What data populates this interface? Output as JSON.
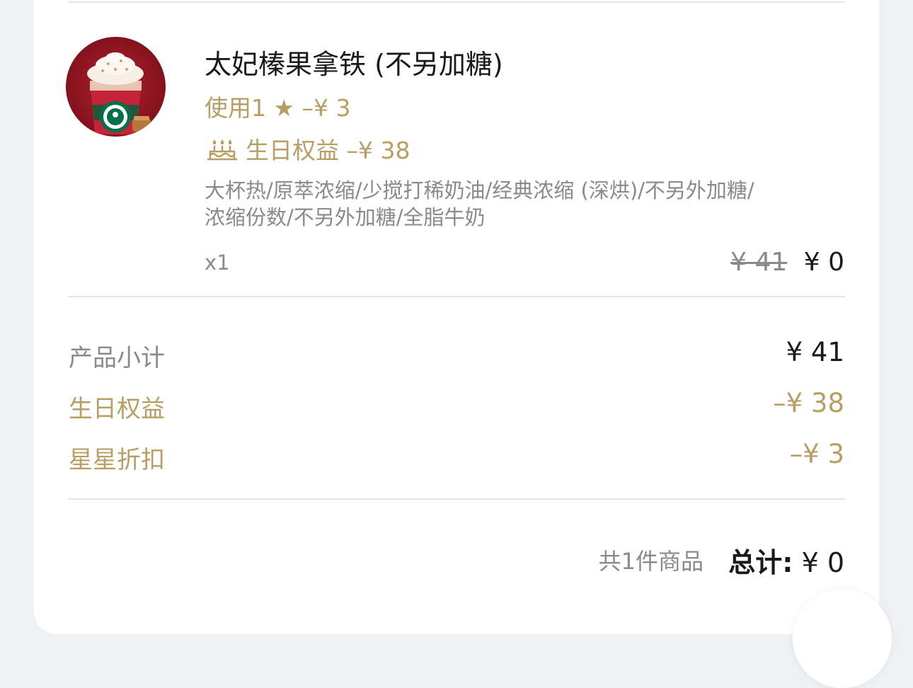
{
  "product": {
    "name": "太妃榛果拿铁 (不另加糖)",
    "star_discount": "使用1 ★ –¥ 3",
    "birthday_benefit": "生日权益 –¥ 38",
    "options_line1": "大杯热/原萃浓缩/少搅打稀奶油/经典浓缩 (深烘)/不另外加糖/",
    "options_line2": "浓缩份数/不另外加糖/全脂牛奶",
    "quantity": "x1",
    "original_price": "¥ 41",
    "final_price": "¥ 0",
    "image_icon": "starbucks-cup-image"
  },
  "summary": {
    "subtotal_label": "产品小计",
    "subtotal_value": "¥ 41",
    "birthday_label": "生日权益",
    "birthday_value": "–¥ 38",
    "star_label": "星星折扣",
    "star_value": "–¥ 3"
  },
  "footer": {
    "item_count": "共1件商品",
    "total_label": "总计:",
    "total_value": "¥ 0"
  },
  "colors": {
    "gold": "#b99e64",
    "text": "#1a1a1a",
    "muted": "#8a8a8a",
    "background": "#eef0f3"
  }
}
